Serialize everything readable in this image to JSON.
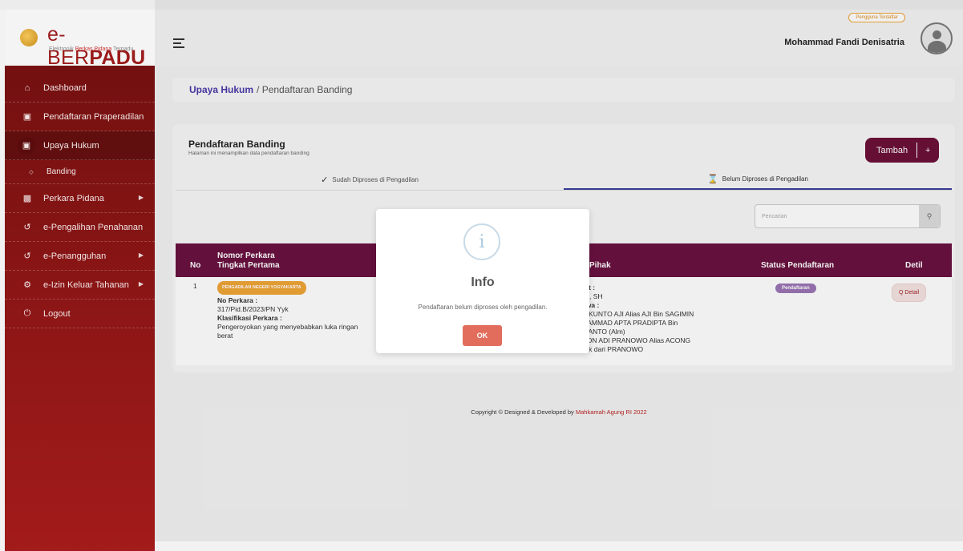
{
  "brand": {
    "name_bold": "e-BER",
    "name_rest": "PADU",
    "tag_a": "Elektronik ",
    "tag_b": "Berkas Pidana",
    "tag_c": " Terpadu"
  },
  "header": {
    "badge": "Pengguna Terdaftar",
    "user": "Mohammad Fandi Denisatria"
  },
  "sidebar": {
    "items": [
      {
        "label": "Dashboard"
      },
      {
        "label": "Pendaftaran Praperadilan"
      },
      {
        "label": "Upaya Hukum"
      },
      {
        "label": "Banding"
      },
      {
        "label": "Perkara Pidana"
      },
      {
        "label": "e-Pengalihan Penahanan"
      },
      {
        "label": "e-Penangguhan"
      },
      {
        "label": "e-Izin Keluar Tahanan"
      },
      {
        "label": "Logout"
      }
    ]
  },
  "breadcrumb": {
    "link": "Upaya Hukum",
    "current": "/ Pendaftaran Banding"
  },
  "card": {
    "title": "Pendaftaran Banding",
    "subtitle": "Halaman ini menampilkan data pendaftaran banding",
    "add_label": "Tambah",
    "add_icon": "+",
    "tabs": [
      {
        "label": "Sudah Diproses di Pengadilan"
      },
      {
        "label": "Belum Diproses di Pengadilan"
      }
    ],
    "search_placeholder": "Pencarian"
  },
  "table": {
    "headers": {
      "no": "No",
      "nomor_1": "Nomor Perkara",
      "nomor_2": "Tingkat Pertama",
      "pihak": "Pihak",
      "status": "Status Pendaftaran",
      "detil": "Detil"
    },
    "rows": [
      {
        "no": "1",
        "court": "PENGADILAN NEGERI YOGYAKARTA",
        "nomor_label": "No Perkara :",
        "nomor": "317/Pid.B/2023/PN Yyk",
        "klas_label": "Klasifikasi Perkara :",
        "klas_1": "Pengeroyokan yang menyebabkan luka ringan",
        "klas_2": "berat",
        "pihak_1": "...tut :",
        "pihak_2": "...nti, SH",
        "pihak_3": "...kwa :",
        "pihak_4": "...S KUNTO AJI Alias AJI Bin SAGIMIN",
        "pihak_5": "...HAMMAD APTA PRADIPTA Bin",
        "pihak_6": "...IYANTO (Alm)",
        "pihak_7": "...SON ADI PRANOWO Alias ACONG",
        "pihak_8": "Anak dari PRANOWO",
        "status": "Pendaftaran",
        "detail": "Q Detail"
      }
    ]
  },
  "footer": {
    "text": "Copyright © Designed & Developed by ",
    "link": "Mahkamah Agung RI 2022"
  },
  "modal": {
    "icon": "i",
    "title": "Info",
    "message": "Pendaftaran belum diproses oleh pengadilan.",
    "ok": "OK"
  },
  "colors": {
    "primary": "#6d1039",
    "sidebar": "#8a1515",
    "accent": "#e26d5c",
    "court": "#f0a537"
  }
}
